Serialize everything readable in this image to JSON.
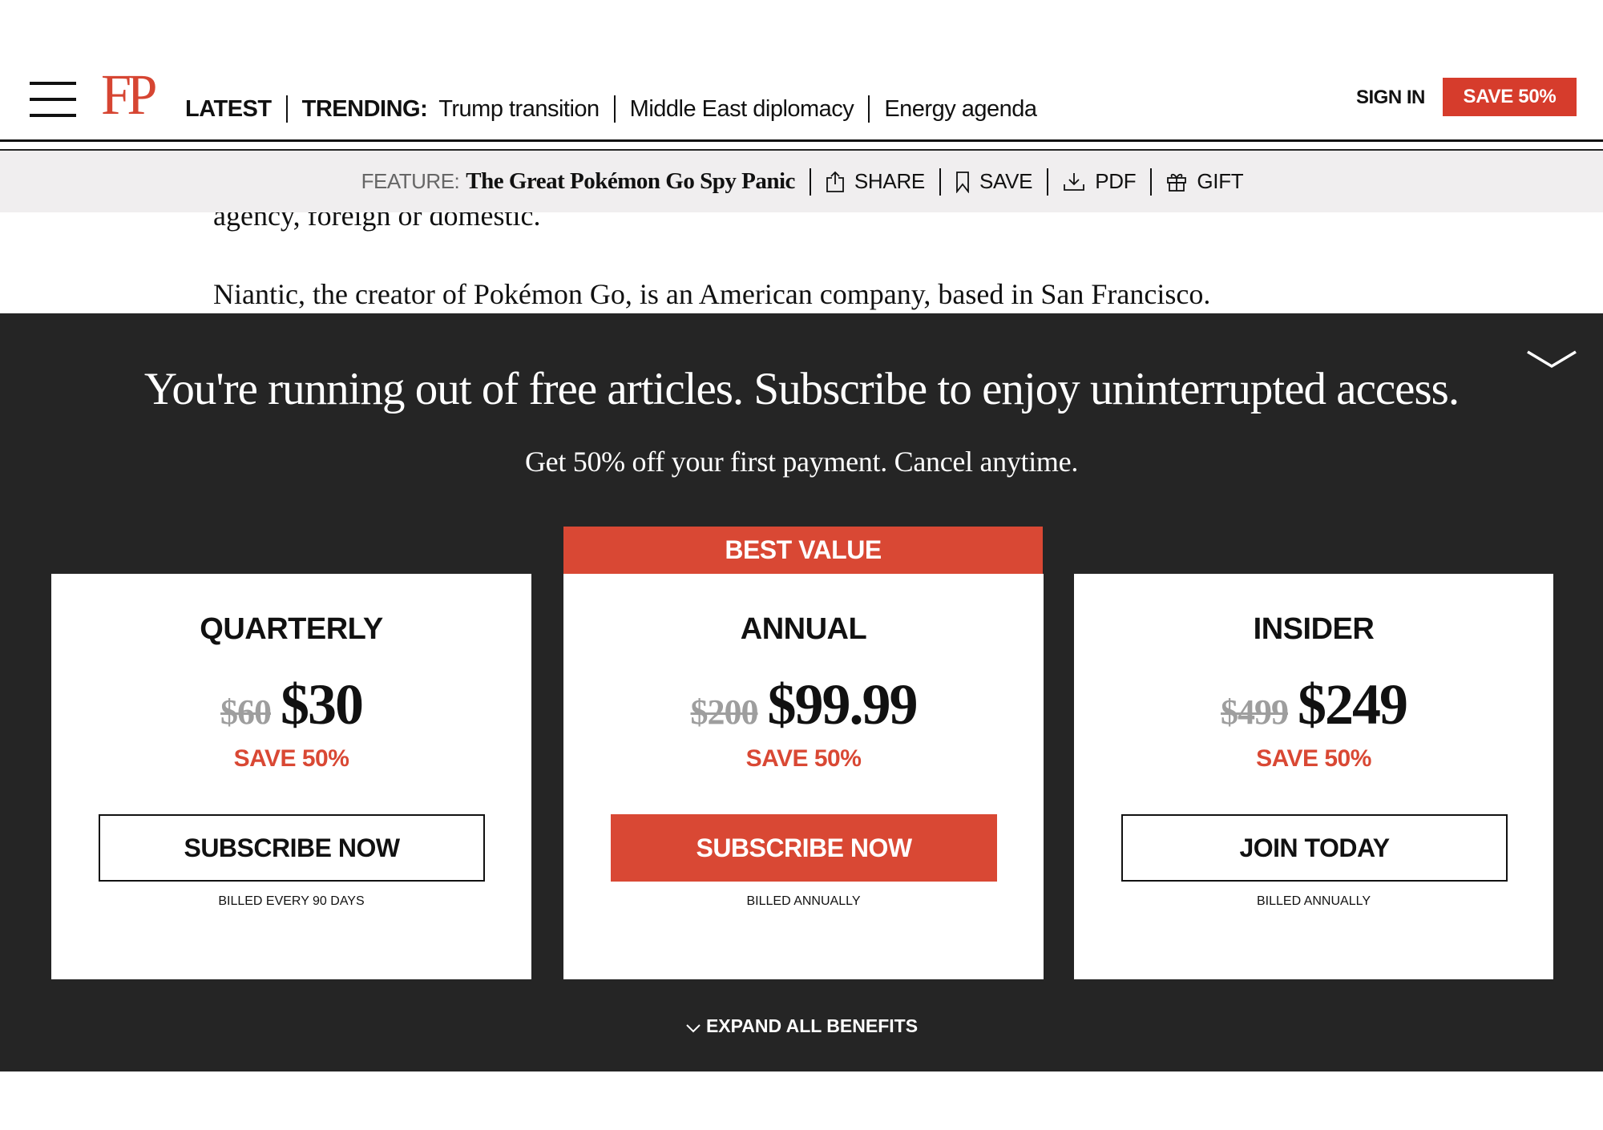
{
  "header": {
    "logo": "FP",
    "nav": {
      "latest": "LATEST",
      "trending_label": "TRENDING:",
      "trending_links": [
        "Trump transition",
        "Middle East diplomacy",
        "Energy agenda"
      ]
    },
    "sign_in": "SIGN IN",
    "save_button": "SAVE 50%"
  },
  "feature_bar": {
    "label": "FEATURE:",
    "title": "The Great Pokémon Go Spy Panic",
    "actions": [
      {
        "label": "SHARE",
        "icon": "share-icon"
      },
      {
        "label": "SAVE",
        "icon": "bookmark-icon"
      },
      {
        "label": "PDF",
        "icon": "download-icon"
      },
      {
        "label": "GIFT",
        "icon": "gift-icon"
      }
    ]
  },
  "article": {
    "paragraphs": [
      "agency, foreign or domestic.",
      "Niantic, the creator of Pokémon Go, is an American company, based in San Francisco."
    ]
  },
  "paywall": {
    "headline": "You're running out of free articles. Subscribe to enjoy uninterrupted access.",
    "subhead": "Get 50% off your first payment. Cancel anytime.",
    "best_value_badge": "BEST VALUE",
    "plans": [
      {
        "name": "QUARTERLY",
        "old_price": "$60",
        "price": "$30",
        "savings": "SAVE 50%",
        "cta": "SUBSCRIBE NOW",
        "billing": "BILLED EVERY 90 DAYS"
      },
      {
        "name": "ANNUAL",
        "old_price": "$200",
        "price": "$99.99",
        "savings": "SAVE 50%",
        "cta": "SUBSCRIBE NOW",
        "billing": "BILLED ANNUALLY"
      },
      {
        "name": "INSIDER",
        "old_price": "$499",
        "price": "$249",
        "savings": "SAVE 50%",
        "cta": "JOIN TODAY",
        "billing": "BILLED ANNUALLY"
      }
    ],
    "expand_label": "EXPAND ALL BENEFITS"
  },
  "colors": {
    "brand_red": "#d94834",
    "overlay_bg": "#252525",
    "feature_bar_bg": "#f0eeef",
    "strike_gray": "#9e9e9e"
  }
}
